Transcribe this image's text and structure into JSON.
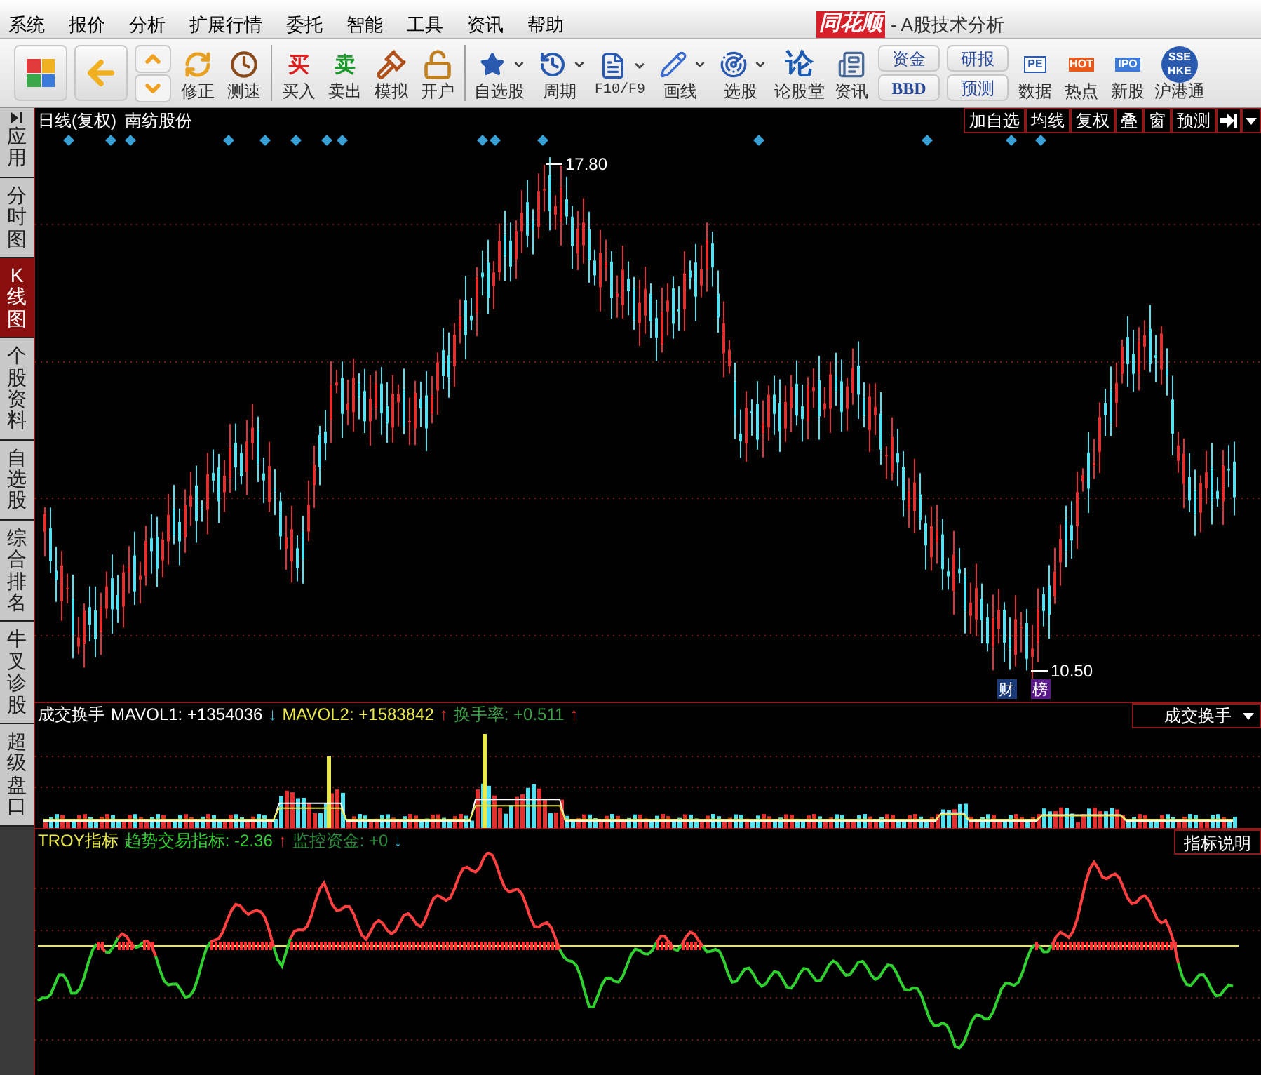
{
  "window": {
    "logo": "同花顺",
    "title": "- A股技术分析"
  },
  "menu": [
    "系统",
    "报价",
    "分析",
    "扩展行情",
    "委托",
    "智能",
    "工具",
    "资讯",
    "帮助"
  ],
  "toolbar": [
    {
      "kind": "icon"
    },
    {
      "kind": "icon"
    },
    {
      "kind": "arrows"
    },
    {
      "kind": "labeled",
      "label": "修正"
    },
    {
      "kind": "labeled",
      "label": "测速"
    },
    {
      "kind": "separator"
    },
    {
      "kind": "labeled",
      "label": "买入",
      "glyph": "买"
    },
    {
      "kind": "labeled",
      "label": "卖出",
      "glyph": "卖"
    },
    {
      "kind": "labeled",
      "label": "模拟"
    },
    {
      "kind": "labeled",
      "label": "开户"
    },
    {
      "kind": "separator"
    },
    {
      "kind": "labeled",
      "label": "自选股",
      "dropdown": true
    },
    {
      "kind": "labeled",
      "label": "周期",
      "dropdown": true
    },
    {
      "kind": "labeled",
      "label": "F10/F9",
      "dropdown": true
    },
    {
      "kind": "labeled",
      "label": "画线",
      "dropdown": true
    },
    {
      "kind": "labeled",
      "label": "选股",
      "dropdown": true
    },
    {
      "kind": "labeled",
      "label": "论股堂",
      "glyph": "论"
    },
    {
      "kind": "labeled",
      "label": "资讯"
    },
    {
      "kind": "stack",
      "labels": [
        "资金",
        "BBD"
      ]
    },
    {
      "kind": "stack",
      "labels": [
        "研报",
        "预测"
      ]
    },
    {
      "kind": "labeled",
      "label": "数据",
      "glyph": "PE"
    },
    {
      "kind": "labeled",
      "label": "热点",
      "glyph": "HOT"
    },
    {
      "kind": "labeled",
      "label": "新股",
      "glyph": "IPO"
    },
    {
      "kind": "labeled",
      "label": "沪港通",
      "glyph": "SSE HKE"
    }
  ],
  "sidebar": [
    {
      "label": "应用",
      "selected": false
    },
    {
      "label": "分时图",
      "selected": false
    },
    {
      "label": "K线图",
      "selected": true
    },
    {
      "label": "个股资料",
      "selected": false
    },
    {
      "label": "自选股",
      "selected": false
    },
    {
      "label": "综合排名",
      "selected": false
    },
    {
      "label": "牛叉诊股",
      "selected": false
    },
    {
      "label": "超级盘口",
      "selected": false
    }
  ],
  "chart": {
    "period": "日线(复权)",
    "stock": "南纺股份",
    "buttons": [
      "加自选",
      "均线",
      "复权",
      "叠",
      "窗",
      "预测"
    ],
    "high_label": "17.80",
    "low_label": "10.50",
    "badges": [
      "财",
      "榜"
    ]
  },
  "volume_panel": {
    "legend": [
      {
        "text": "成交换手",
        "color": "#ffffff"
      },
      {
        "text": "MAVOL1: +1354036",
        "color": "#ffffff"
      },
      {
        "text": "↓",
        "color": "#4fc3e0"
      },
      {
        "text": "MAVOL2: +1583842",
        "color": "#e8e84a"
      },
      {
        "text": "↑",
        "color": "#e03030"
      },
      {
        "text": "换手率: +0.511",
        "color": "#3fa04a"
      },
      {
        "text": "↑",
        "color": "#e03030"
      }
    ],
    "selector": "成交换手"
  },
  "indicator_panel": {
    "legend": [
      {
        "text": "TROY指标",
        "color": "#e8e84a"
      },
      {
        "text": "趋势交易指标: -2.36",
        "color": "#33cc33"
      },
      {
        "text": "↑",
        "color": "#e03030"
      },
      {
        "text": "监控资金: +0",
        "color": "#2a8a3a"
      },
      {
        "text": "↓",
        "color": "#4fc3e0"
      }
    ],
    "button": "指标说明"
  }
}
